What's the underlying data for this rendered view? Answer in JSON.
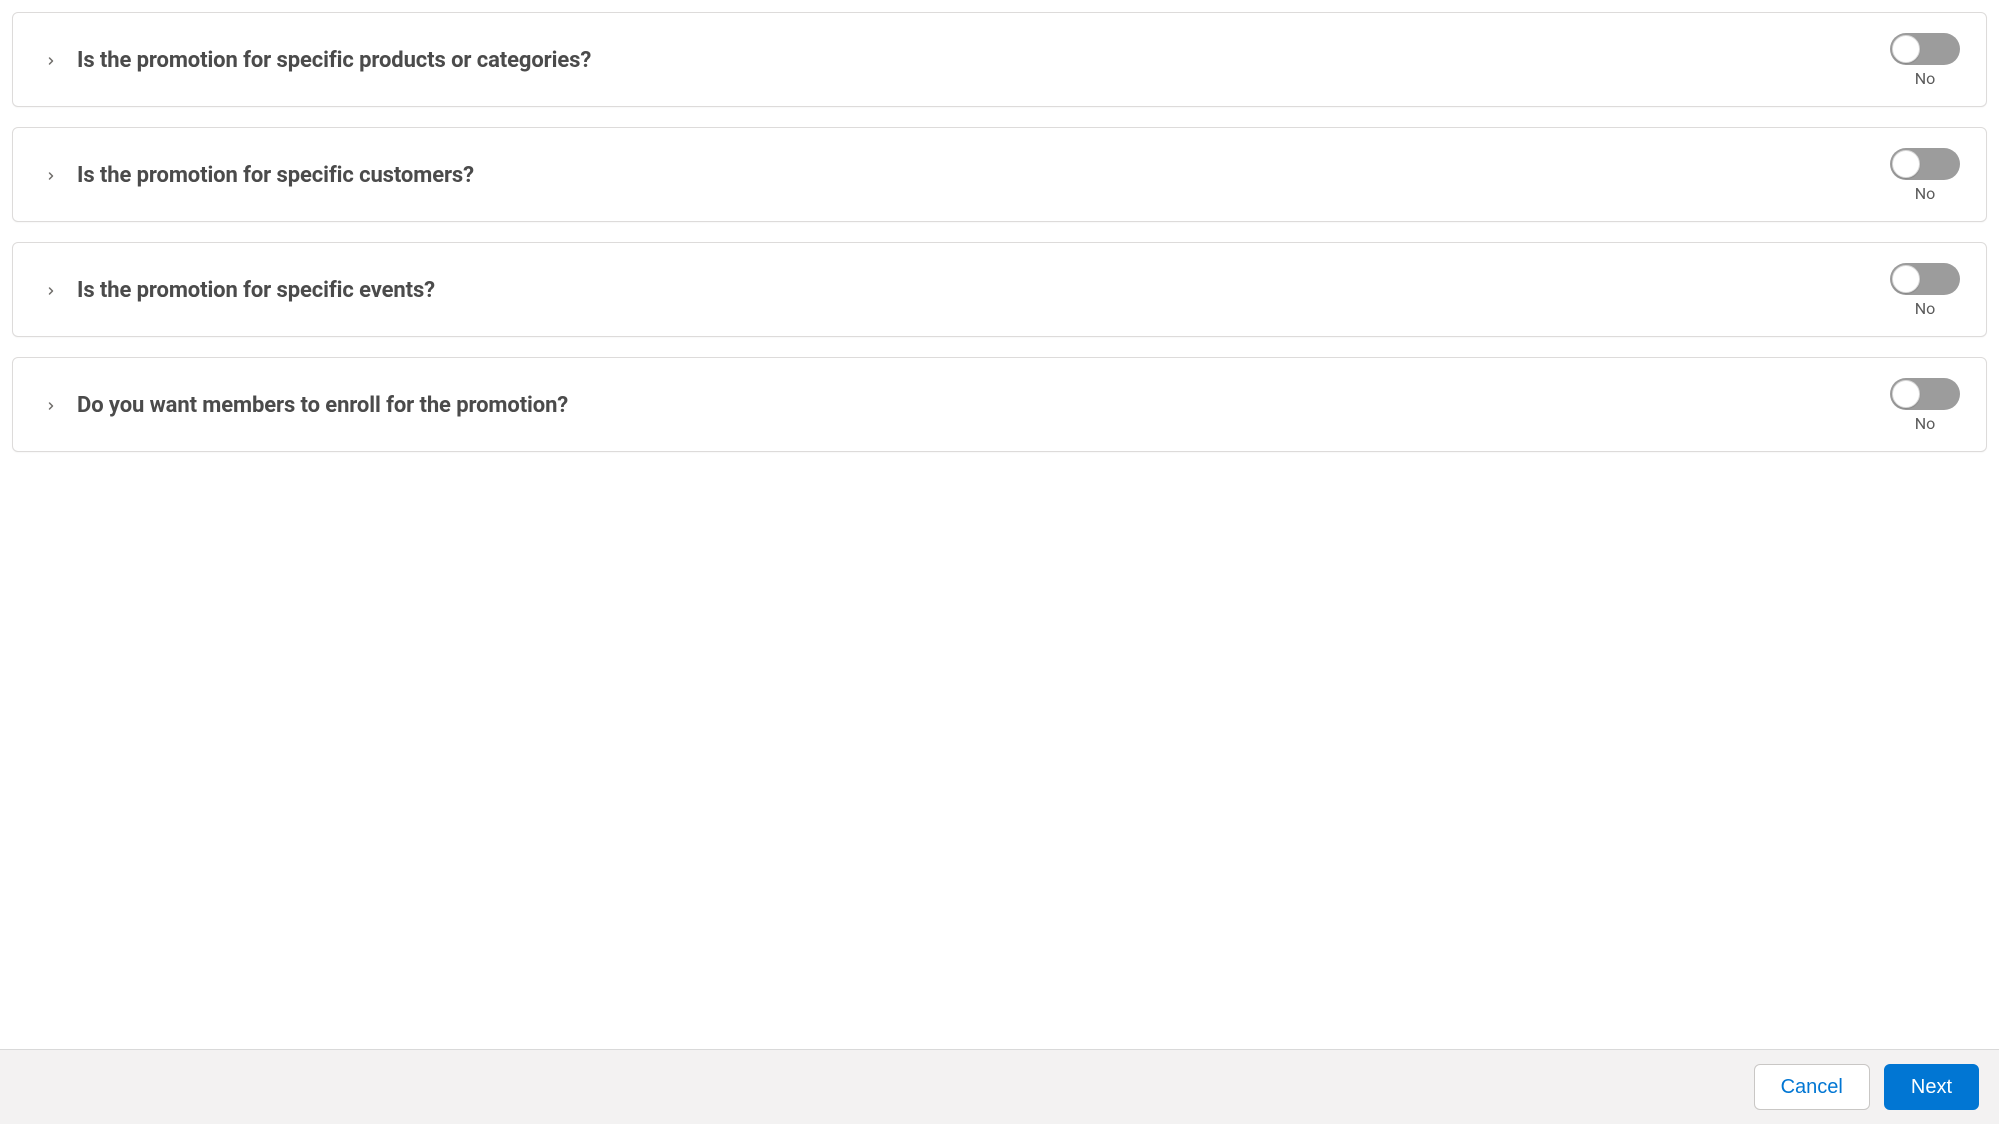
{
  "questions": [
    {
      "id": "products-categories",
      "label": "Is the promotion for specific products or categories?",
      "value": false,
      "toggle_label": "No"
    },
    {
      "id": "customers",
      "label": "Is the promotion for specific customers?",
      "value": false,
      "toggle_label": "No"
    },
    {
      "id": "events",
      "label": "Is the promotion for specific events?",
      "value": false,
      "toggle_label": "No"
    },
    {
      "id": "enroll",
      "label": "Do you want members to enroll for the promotion?",
      "value": false,
      "toggle_label": "No"
    }
  ],
  "footer": {
    "cancel_label": "Cancel",
    "next_label": "Next"
  }
}
